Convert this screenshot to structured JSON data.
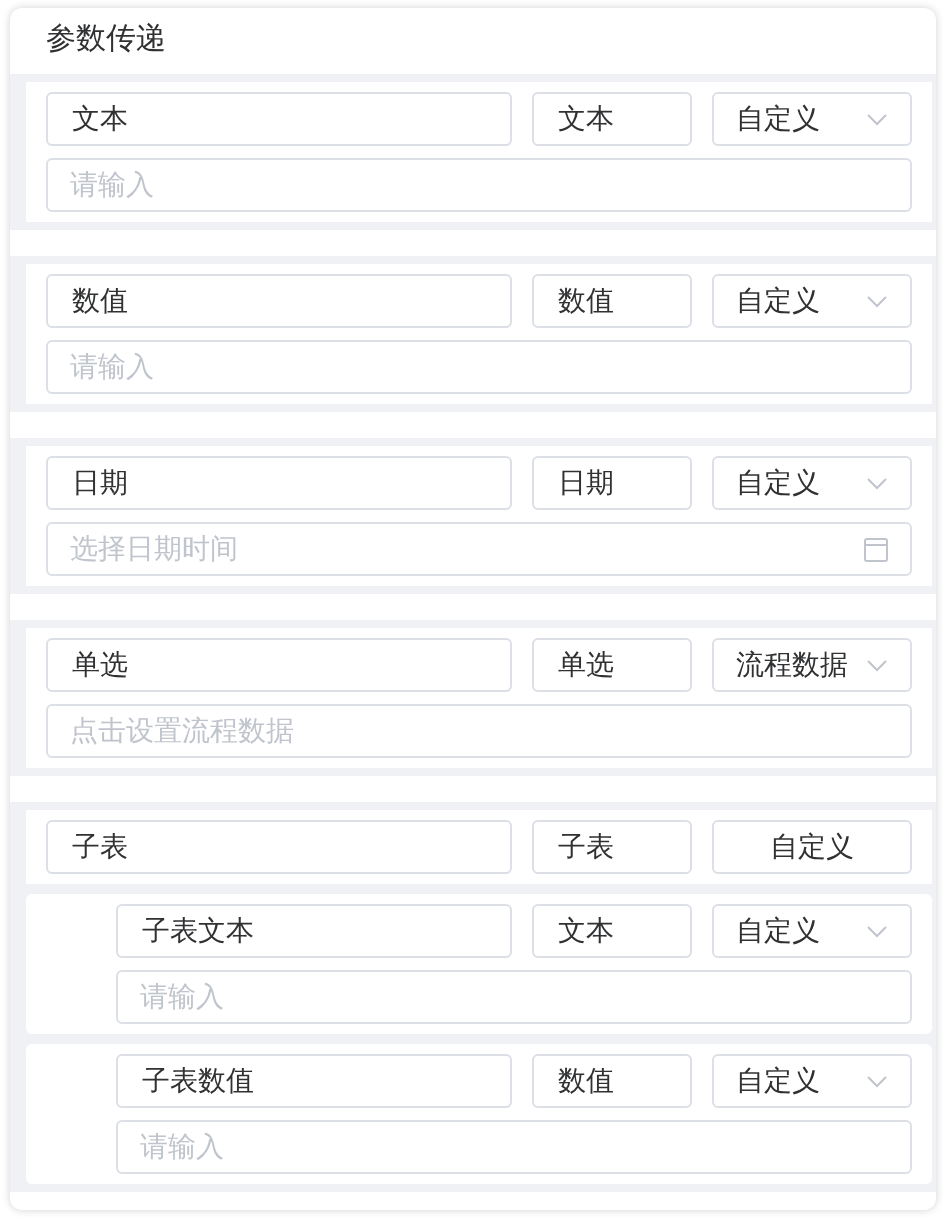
{
  "title": "参数传递",
  "params": [
    {
      "name": "文本",
      "type": "文本",
      "source": {
        "label": "自定义",
        "dropdown": true
      },
      "value": {
        "kind": "input",
        "placeholder": "请输入"
      }
    },
    {
      "name": "数值",
      "type": "数值",
      "source": {
        "label": "自定义",
        "dropdown": true
      },
      "value": {
        "kind": "input",
        "placeholder": "请输入"
      }
    },
    {
      "name": "日期",
      "type": "日期",
      "source": {
        "label": "自定义",
        "dropdown": true
      },
      "value": {
        "kind": "date",
        "placeholder": "选择日期时间"
      }
    },
    {
      "name": "单选",
      "type": "单选",
      "source": {
        "label": "流程数据",
        "dropdown": true
      },
      "value": {
        "kind": "input",
        "placeholder": "点击设置流程数据"
      }
    },
    {
      "name": "子表",
      "type": "子表",
      "source": {
        "label": "自定义",
        "dropdown": false
      },
      "children": [
        {
          "name": "子表文本",
          "type": "文本",
          "source": {
            "label": "自定义",
            "dropdown": true
          },
          "value": {
            "kind": "input",
            "placeholder": "请输入"
          }
        },
        {
          "name": "子表数值",
          "type": "数值",
          "source": {
            "label": "自定义",
            "dropdown": true
          },
          "value": {
            "kind": "input",
            "placeholder": "请输入"
          }
        }
      ]
    }
  ]
}
